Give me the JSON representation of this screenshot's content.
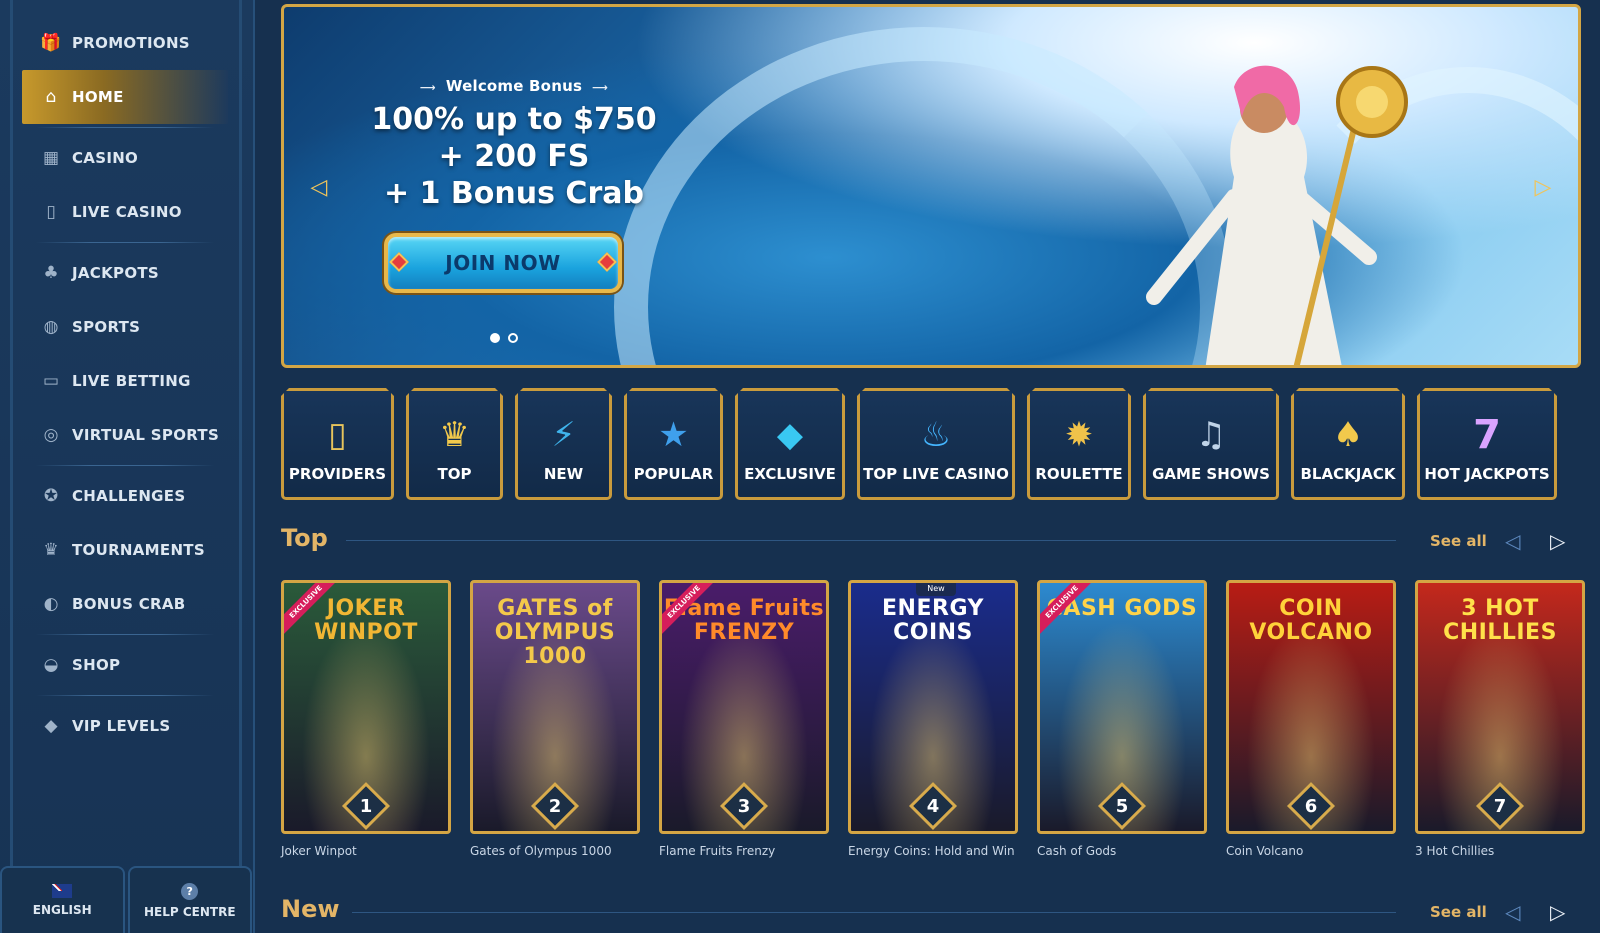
{
  "sidebar": {
    "items": [
      {
        "label": "PROMOTIONS",
        "icon": "gift-icon"
      },
      {
        "label": "HOME",
        "icon": "home-icon",
        "active": true
      },
      {
        "label": "CASINO",
        "icon": "slot-machine-icon"
      },
      {
        "label": "LIVE CASINO",
        "icon": "card-icon"
      },
      {
        "label": "JACKPOTS",
        "icon": "clover-icon"
      },
      {
        "label": "SPORTS",
        "icon": "ball-icon"
      },
      {
        "label": "LIVE BETTING",
        "icon": "live-icon"
      },
      {
        "label": "VIRTUAL SPORTS",
        "icon": "virtual-icon"
      },
      {
        "label": "CHALLENGES",
        "icon": "medal-icon"
      },
      {
        "label": "TOURNAMENTS",
        "icon": "trophy-icon"
      },
      {
        "label": "BONUS CRAB",
        "icon": "crab-icon"
      },
      {
        "label": "SHOP",
        "icon": "basket-icon"
      },
      {
        "label": "VIP LEVELS",
        "icon": "diamond-icon"
      }
    ],
    "language_label": "ENGLISH",
    "help_label": "HELP CENTRE"
  },
  "banner": {
    "subtitle": "Welcome Bonus",
    "line1": "100% up to $750",
    "line2": "+ 200 FS",
    "line3": "+ 1 Bonus Crab",
    "cta_label": "JOIN NOW",
    "slide_count": 2,
    "active_slide": 1
  },
  "categories": [
    {
      "label": "PROVIDERS",
      "icon": "card-icon"
    },
    {
      "label": "TOP",
      "icon": "crown-icon"
    },
    {
      "label": "NEW",
      "icon": "lightning-icon"
    },
    {
      "label": "POPULAR",
      "icon": "star-icon"
    },
    {
      "label": "EXCLUSIVE",
      "icon": "diamond-icon"
    },
    {
      "label": "TOP LIVE CASINO",
      "icon": "torch-icon"
    },
    {
      "label": "ROULETTE",
      "icon": "roulette-icon"
    },
    {
      "label": "GAME SHOWS",
      "icon": "microphone-icon"
    },
    {
      "label": "BLACKJACK",
      "icon": "cards-icon"
    },
    {
      "label": "HOT JACKPOTS",
      "icon": "seven-icon"
    }
  ],
  "top_section": {
    "title": "Top",
    "see_all": "See all",
    "games": [
      {
        "name": "Joker Winpot",
        "rank": "1",
        "art_title": "JOKER WINPOT",
        "badge": "EXCLUSIVE",
        "bg": "#2a5a3a",
        "title_color": "#f1b634"
      },
      {
        "name": "Gates of Olympus 1000",
        "rank": "2",
        "art_title": "GATES of OLYMPUS 1000",
        "badge": "",
        "bg": "#6a4a8a",
        "title_color": "#f4c94a"
      },
      {
        "name": "Flame Fruits Frenzy",
        "rank": "3",
        "art_title": "Flame Fruits FRENZY",
        "badge": "EXCLUSIVE",
        "bg": "#4a1c6a",
        "title_color": "#ff8a2a"
      },
      {
        "name": "Energy Coins: Hold and Win",
        "rank": "4",
        "art_title": "ENERGY COINS",
        "badge": "New",
        "bg": "#1a2c8c",
        "title_color": "#ffffff"
      },
      {
        "name": "Cash of Gods",
        "rank": "5",
        "art_title": "CASH GODS",
        "badge": "EXCLUSIVE",
        "bg": "#2c8ad0",
        "title_color": "#ffd34a"
      },
      {
        "name": "Coin Volcano",
        "rank": "6",
        "art_title": "COIN VOLCANO",
        "badge": "",
        "bg": "#b81c14",
        "title_color": "#ffd23a"
      },
      {
        "name": "3 Hot Chillies",
        "rank": "7",
        "art_title": "3 HOT CHILLIES",
        "badge": "",
        "bg": "#c4281c",
        "title_color": "#ffe14a"
      }
    ]
  },
  "new_section": {
    "title": "New",
    "see_all": "See all"
  },
  "colors": {
    "accent_gold": "#d3a645",
    "background": "#16304f",
    "section_title": "#e3b567"
  }
}
